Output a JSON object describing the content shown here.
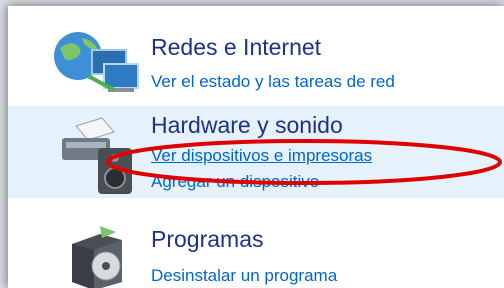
{
  "categories": {
    "network": {
      "title": "Redes e Internet",
      "links": [
        "Ver el estado y las tareas de red"
      ],
      "icon": "network-globe-icon"
    },
    "hardware": {
      "title": "Hardware y sonido",
      "links": [
        "Ver dispositivos e impresoras",
        "Agregar un dispositivo"
      ],
      "icon": "printer-speaker-icon",
      "highlight_color": "#e5f1fb"
    },
    "programs": {
      "title": "Programas",
      "links": [
        "Desinstalar un programa"
      ],
      "icon": "programs-box-disc-icon"
    }
  },
  "colors": {
    "title": "#1e3287",
    "link": "#0066cc",
    "annotation": "#e00000"
  }
}
